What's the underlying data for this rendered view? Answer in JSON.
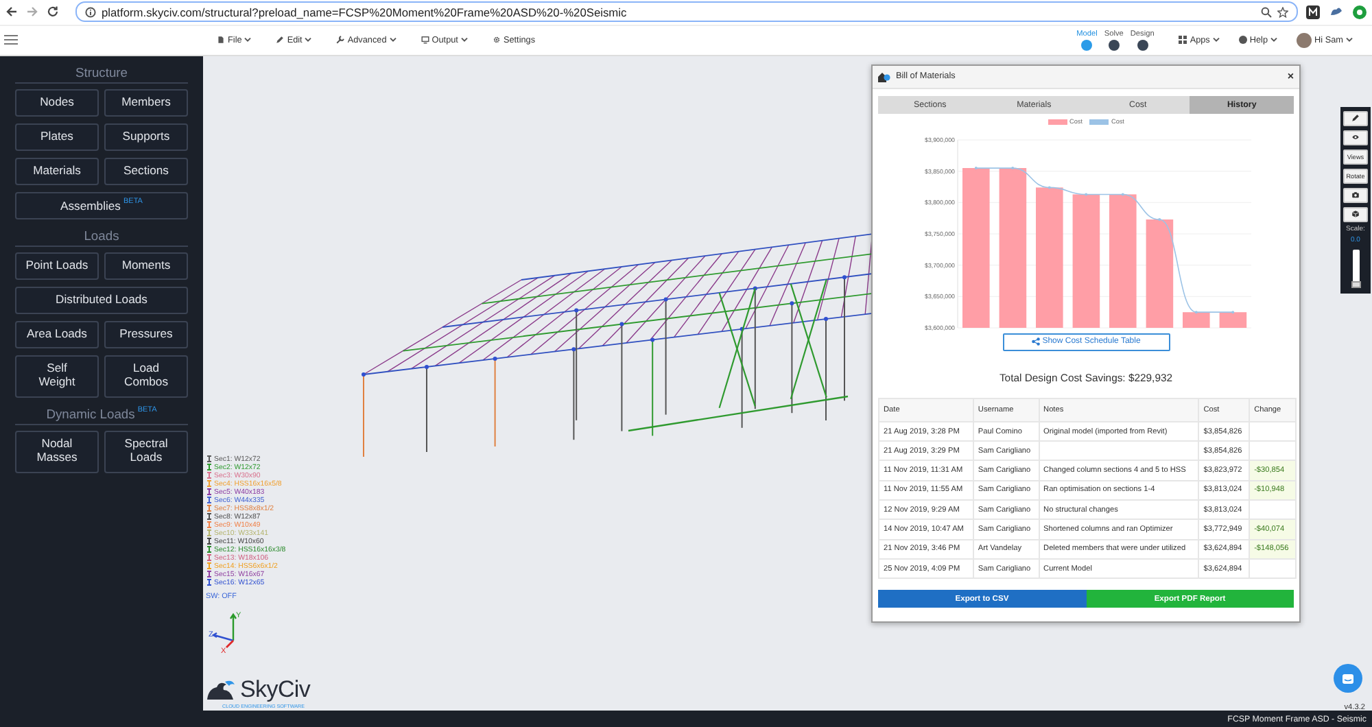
{
  "browser": {
    "url": "platform.skyciv.com/structural?preload_name=FCSP%20Moment%20Frame%20ASD%20-%20Seismic"
  },
  "toolbar": {
    "menus": [
      {
        "label": "File"
      },
      {
        "label": "Edit"
      },
      {
        "label": "Advanced"
      },
      {
        "label": "Output"
      },
      {
        "label": "Settings"
      }
    ],
    "steps": [
      {
        "label": "Model",
        "selected": true
      },
      {
        "label": "Solve",
        "selected": false
      },
      {
        "label": "Design",
        "selected": false
      }
    ],
    "apps": "Apps",
    "help": "Help",
    "user": "Hi Sam"
  },
  "sidebar": {
    "sections": [
      {
        "heading": "Structure",
        "buttons": [
          {
            "label": "Nodes",
            "kind": "half"
          },
          {
            "label": "Members",
            "kind": "half"
          },
          {
            "label": "Plates",
            "kind": "half"
          },
          {
            "label": "Supports",
            "kind": "half"
          },
          {
            "label": "Materials",
            "kind": "half"
          },
          {
            "label": "Sections",
            "kind": "half"
          },
          {
            "label": "Assemblies",
            "badge": "BETA",
            "kind": "wide"
          }
        ]
      },
      {
        "heading": "Loads",
        "buttons": [
          {
            "label": "Point Loads",
            "kind": "half"
          },
          {
            "label": "Moments",
            "kind": "half"
          },
          {
            "label": "Distributed Loads",
            "kind": "wide"
          },
          {
            "label": "Area Loads",
            "kind": "half"
          },
          {
            "label": "Pressures",
            "kind": "half"
          },
          {
            "label": "Self\nWeight",
            "kind": "half"
          },
          {
            "label": "Load\nCombos",
            "kind": "half"
          }
        ]
      },
      {
        "heading": "Dynamic Loads",
        "badge": "BETA",
        "buttons": [
          {
            "label": "Nodal\nMasses",
            "kind": "half"
          },
          {
            "label": "Spectral\nLoads",
            "kind": "half"
          }
        ]
      }
    ]
  },
  "legend": [
    {
      "label": "Sec1: W12x72",
      "color": "#5a5a5a"
    },
    {
      "label": "Sec2: W12x72",
      "color": "#2f9a2f"
    },
    {
      "label": "Sec3: W30x90",
      "color": "#d8708c"
    },
    {
      "label": "Sec4: HSS16x16x5/8",
      "color": "#f0a030"
    },
    {
      "label": "Sec5: W40x183",
      "color": "#8a3aa0"
    },
    {
      "label": "Sec6: W44x335",
      "color": "#4060d0"
    },
    {
      "label": "Sec7: HSS8x8x1/2",
      "color": "#e08040"
    },
    {
      "label": "Sec8: W12x87",
      "color": "#505050"
    },
    {
      "label": "Sec9: W10x49",
      "color": "#f08048"
    },
    {
      "label": "Sec10: W33x141",
      "color": "#b4b46e"
    },
    {
      "label": "Sec11: W10x60",
      "color": "#444444"
    },
    {
      "label": "Sec12: HSS16x16x3/8",
      "color": "#2a8a2a"
    },
    {
      "label": "Sec13: W18x106",
      "color": "#d06080"
    },
    {
      "label": "Sec14: HSS6x6x1/2",
      "color": "#f0a020"
    },
    {
      "label": "Sec15: W16x67",
      "color": "#9040a0"
    },
    {
      "label": "Sec16: W12x65",
      "color": "#3050d0"
    }
  ],
  "sw_status": "SW: OFF",
  "axes": {
    "y": "Y",
    "z": "Z",
    "x": "X"
  },
  "logo": {
    "name": "SkyCiv",
    "tagline": "CLOUD ENGINEERING SOFTWARE"
  },
  "bom": {
    "title": "Bill of Materials",
    "close": "×",
    "tabs": [
      {
        "label": "Sections",
        "selected": false
      },
      {
        "label": "Materials",
        "selected": false
      },
      {
        "label": "Cost",
        "selected": false
      },
      {
        "label": "History",
        "selected": true
      }
    ],
    "chart_data": {
      "type": "bar",
      "grid": true,
      "ylim": [
        3600000,
        3900000
      ],
      "yticks": [
        {
          "value": 3900000,
          "label": "$3,900,000"
        },
        {
          "value": 3850000,
          "label": "$3,850,000"
        },
        {
          "value": 3800000,
          "label": "$3,800,000"
        },
        {
          "value": 3750000,
          "label": "$3,750,000"
        },
        {
          "value": 3700000,
          "label": "$3,700,000"
        },
        {
          "value": 3650000,
          "label": "$3,650,000"
        },
        {
          "value": 3600000,
          "label": "$3,600,000"
        }
      ],
      "series": [
        {
          "name": "Cost",
          "type": "bar",
          "color": "#ff9ea6",
          "values": [
            3855000,
            3855000,
            3824000,
            3813000,
            3813000,
            3773000,
            3625000,
            3625000
          ]
        },
        {
          "name": "Cost",
          "type": "line",
          "color": "#9cc3e6",
          "values": [
            3855000,
            3855000,
            3824000,
            3813000,
            3813000,
            3773000,
            3625000,
            3625000
          ]
        }
      ]
    },
    "schedule_button": "Show Cost Schedule Table",
    "savings": "Total Design Cost Savings: $229,932",
    "columns": [
      "Date",
      "Username",
      "Notes",
      "Cost",
      "Change"
    ],
    "rows": [
      {
        "date": "21 Aug 2019, 3:28 PM",
        "username": "Paul Comino",
        "notes": "Original model (imported from Revit)",
        "cost": "$3,854,826"
      },
      {
        "date": "21 Aug 2019, 3:29 PM",
        "username": "Sam Carigliano",
        "cost": "$3,854,826"
      },
      {
        "date": "11 Nov 2019, 11:31 AM",
        "username": "Sam Carigliano",
        "notes": "Changed column sections 4 and 5 to HSS",
        "cost": "$3,823,972",
        "change": "-$30,854"
      },
      {
        "date": "11 Nov 2019, 11:55 AM",
        "username": "Sam Carigliano",
        "notes": "Ran optimisation on sections 1-4",
        "cost": "$3,813,024",
        "change": "-$10,948"
      },
      {
        "date": "12 Nov 2019, 9:29 AM",
        "username": "Sam Carigliano",
        "notes": "No structural changes",
        "cost": "$3,813,024"
      },
      {
        "date": "14 Nov 2019, 10:47 AM",
        "username": "Sam Carigliano",
        "notes": "Shortened columns and ran Optimizer",
        "cost": "$3,772,949",
        "change": "-$40,074"
      },
      {
        "date": "21 Nov 2019, 3:46 PM",
        "username": "Art Vandelay",
        "notes": "Deleted members that were under utilized",
        "cost": "$3,624,894",
        "change": "-$148,056"
      },
      {
        "date": "25 Nov 2019, 4:09 PM",
        "username": "Sam Carigliano",
        "notes": "Current Model",
        "cost": "$3,624,894"
      }
    ],
    "export_buttons": [
      {
        "label": "Export to CSV",
        "kind": "primary"
      },
      {
        "label": "Export PDF Report",
        "kind": "success"
      }
    ]
  },
  "view_tools": {
    "buttons": [
      {
        "kind": "icon"
      },
      {
        "kind": "icon"
      },
      {
        "kind": "text",
        "label": "Views"
      },
      {
        "kind": "text",
        "label": "Rotate"
      },
      {
        "kind": "icon"
      },
      {
        "kind": "icon"
      }
    ],
    "scale_label": "Scale:",
    "scale_value": "0.0",
    "scale": {
      "level": 0
    }
  },
  "version": "v4.3.2",
  "status_bar": {
    "title": "FCSP Moment Frame ASD - Seismic"
  }
}
